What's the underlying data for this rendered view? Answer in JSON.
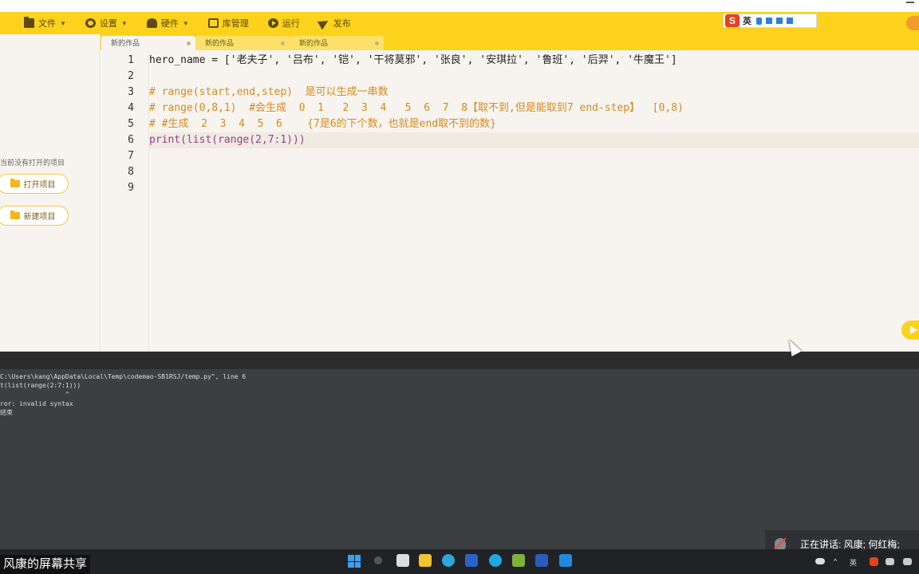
{
  "toolbar": {
    "items": [
      {
        "label": "文件",
        "icon": "folder-icon"
      },
      {
        "label": "设置",
        "icon": "gear-icon"
      },
      {
        "label": "硬件",
        "icon": "hardware-icon"
      },
      {
        "label": "库管理",
        "icon": "library-icon"
      },
      {
        "label": "运行",
        "icon": "run-icon"
      },
      {
        "label": "发布",
        "icon": "publish-icon"
      }
    ]
  },
  "ime": {
    "logo": "S",
    "mode": "英"
  },
  "tabs": [
    {
      "label": "新的作品",
      "active": true
    },
    {
      "label": "新的作品",
      "active": false
    },
    {
      "label": "新的作品",
      "active": false
    }
  ],
  "sidebar": {
    "note": "当前没有打开的项目",
    "open_button": "打开项目",
    "new_button": "新建项目"
  },
  "editor": {
    "line_numbers": [
      "1",
      "2",
      "3",
      "4",
      "5",
      "6",
      "7",
      "8",
      "9"
    ],
    "lines": [
      "hero_name = ['老夫子', '吕布', '铠', '干将莫邪', '张良', '安琪拉', '鲁班', '后羿', '牛魔王']",
      "",
      "# range(start,end,step)  是可以生成一串数",
      "# range(0,8,1)  #会生成  0  1   2  3  4   5  6  7  8【取不到,但是能取到7 end-step】  [0,8)",
      "# #生成  2  3  4  5  6    {7是6的下个数，也就是end取不到的数}",
      "print(list(range(2,7:1)))",
      "",
      "",
      ""
    ]
  },
  "console": {
    "lines": [
      "C:\\Users\\kang\\AppData\\Local\\Temp\\codemao-SB1RSJ/temp.py\", line 6",
      "t(list(range(2:7:1)))",
      "                 ^",
      "ror: invalid syntax",
      "结束"
    ]
  },
  "speaking": {
    "text": "正在讲话: 风康; 何红梅;"
  },
  "taskbar": {
    "share_label": "风康的屏幕共享",
    "tray_lang": "英"
  }
}
